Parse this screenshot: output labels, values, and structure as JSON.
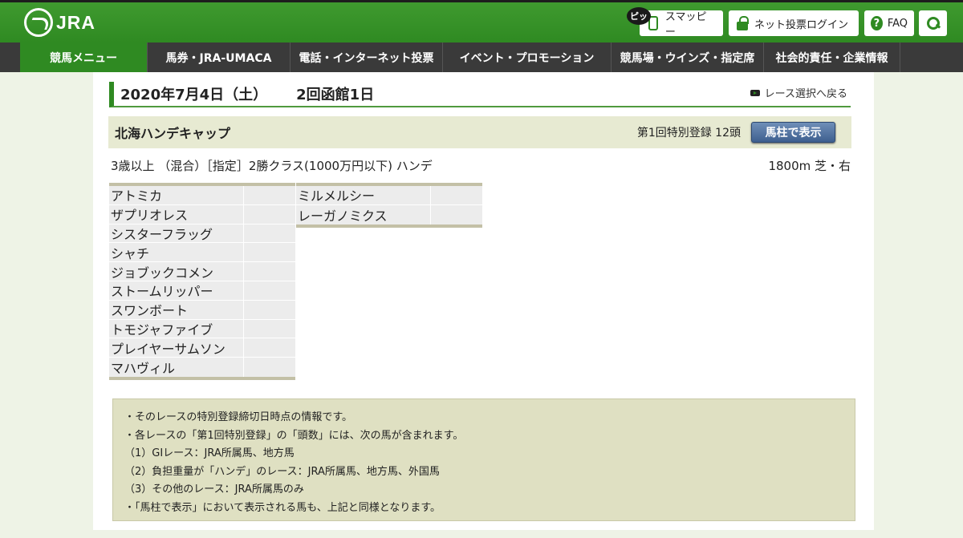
{
  "header": {
    "logo_text": "JRA",
    "pitto_label": "ピッ",
    "smappy_label": "スマッピー",
    "login_label": "ネット投票ログイン",
    "faq_label": "FAQ"
  },
  "nav": {
    "items": [
      {
        "label": "競馬メニュー",
        "width": 159
      },
      {
        "label": "馬券・JRA-UMACA",
        "width": 178
      },
      {
        "label": "電話・インターネット投票",
        "width": 190
      },
      {
        "label": "イベント・プロモーション",
        "width": 210
      },
      {
        "label": "競馬場・ウインズ・指定席",
        "width": 190
      },
      {
        "label": "社会的責任・企業情報",
        "width": 170
      }
    ]
  },
  "race": {
    "date": "2020年7月4日（土）",
    "venue": "2回函館1日",
    "back_link": "レース選択へ戻る",
    "name": "北海ハンデキャップ",
    "registration": "第1回特別登録 12頭",
    "show_button": "馬柱で表示",
    "conditions": "3歳以上 （混合）［指定］2勝クラス(1000万円以下) ハンデ",
    "distance": "1800m 芝・右"
  },
  "horses_col1": [
    "アトミカ",
    "ザプリオレス",
    "シスターフラッグ",
    "シャチ",
    "ジョブックコメン",
    "ストームリッパー",
    "スワンボート",
    "トモジャファイブ",
    "プレイヤーサムソン",
    "マハヴィル"
  ],
  "horses_col2": [
    "ミルメルシー",
    "レーガノミクス"
  ],
  "notes": [
    "・そのレースの特別登録締切日時点の情報です。",
    "・各レースの「第1回特別登録」の「頭数」には、次の馬が含まれます。",
    "（1）GⅠレース：JRA所属馬、地方馬",
    "（2）負担重量が「ハンデ」のレース：JRA所属馬、地方馬、外国馬",
    "（3）その他のレース：JRA所属馬のみ",
    "・「馬柱で表示」において表示される馬も、上記と同様となります。"
  ]
}
